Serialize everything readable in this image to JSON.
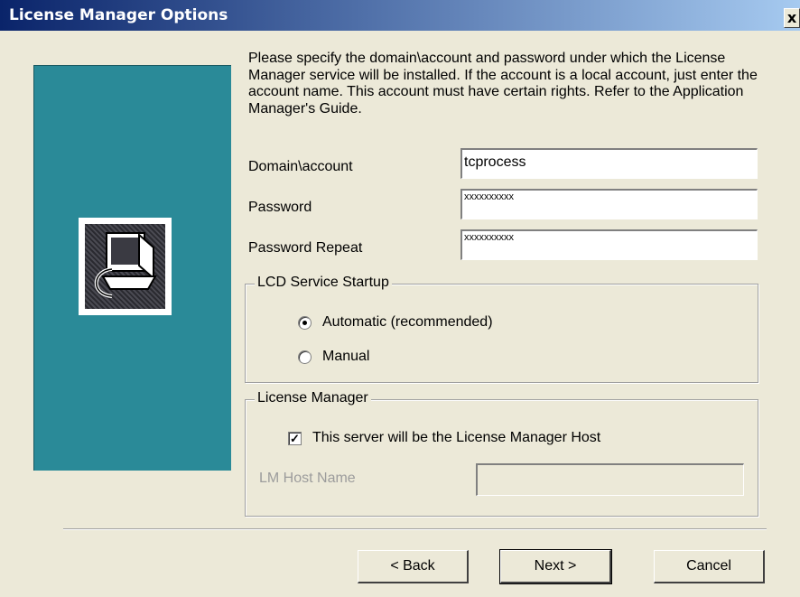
{
  "window": {
    "title": "License Manager Options",
    "close_glyph": "x"
  },
  "intro_text": "Please specify the domain\\account and password under which the License Manager service will be installed.  If the account is a local account, just enter the account name.  This account must have certain rights.  Refer to the Application Manager's Guide.",
  "fields": {
    "domain_account": {
      "label": "Domain\\account",
      "value": "tcprocess"
    },
    "password": {
      "label": "Password",
      "value": "xxxxxxxxxx"
    },
    "password_repeat": {
      "label": "Password Repeat",
      "value": "xxxxxxxxxx"
    }
  },
  "lcd_startup": {
    "title": "LCD Service Startup",
    "options": [
      {
        "label": "Automatic (recommended)",
        "checked": true
      },
      {
        "label": "Manual",
        "checked": false
      }
    ]
  },
  "license_manager": {
    "title": "License Manager",
    "checkbox_label": "This server will be the License Manager Host",
    "checkbox_checked": true,
    "host_name_label": "LM Host Name",
    "host_name_value": ""
  },
  "buttons": {
    "back": "< Back",
    "next": "Next >",
    "cancel": "Cancel"
  },
  "icons": {
    "side_icon": "computer-setup-icon"
  },
  "colors": {
    "side_panel": "#2a8a98",
    "title_bar": "#0a246a",
    "dialog_bg": "#ece9d8"
  }
}
